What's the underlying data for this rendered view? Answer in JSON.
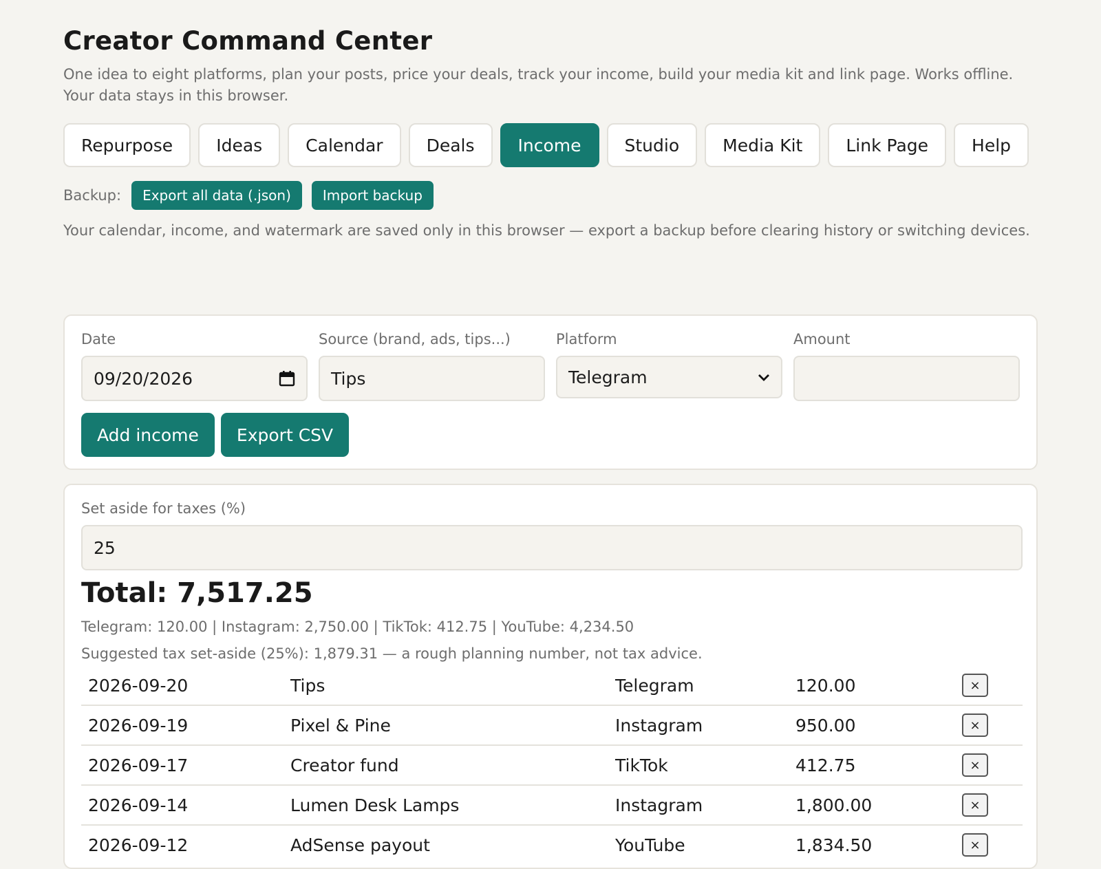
{
  "app": {
    "title": "Creator Command Center",
    "subtitle": "One idea to eight platforms, plan your posts, price your deals, track your income, build your media kit and link page. Works offline. Your data stays in this browser."
  },
  "tabs": [
    {
      "label": "Repurpose",
      "active": false
    },
    {
      "label": "Ideas",
      "active": false
    },
    {
      "label": "Calendar",
      "active": false
    },
    {
      "label": "Deals",
      "active": false
    },
    {
      "label": "Income",
      "active": true
    },
    {
      "label": "Studio",
      "active": false
    },
    {
      "label": "Media Kit",
      "active": false
    },
    {
      "label": "Link Page",
      "active": false
    },
    {
      "label": "Help",
      "active": false
    }
  ],
  "backup": {
    "label": "Backup:",
    "export_label": "Export all data (.json)",
    "import_label": "Import backup",
    "note": "Your calendar, income, and watermark are saved only in this browser — export a backup before clearing history or switching devices."
  },
  "form": {
    "date_label": "Date",
    "date_value": "09/20/2026",
    "source_label": "Source (brand, ads, tips...)",
    "source_value": "Tips",
    "platform_label": "Platform",
    "platform_value": "Telegram",
    "amount_label": "Amount",
    "amount_value": "",
    "add_label": "Add income",
    "export_csv_label": "Export CSV"
  },
  "summary": {
    "tax_label": "Set aside for taxes (%)",
    "tax_value": "25",
    "total": "Total: 7,517.25",
    "breakdown": "Telegram: 120.00 | Instagram: 2,750.00 | TikTok: 412.75 | YouTube: 4,234.50",
    "suggestion": "Suggested tax set-aside (25%): 1,879.31 — a rough planning number, not tax advice."
  },
  "entries": [
    {
      "date": "2026-09-20",
      "source": "Tips",
      "platform": "Telegram",
      "amount": "120.00",
      "delete": "×"
    },
    {
      "date": "2026-09-19",
      "source": "Pixel & Pine",
      "platform": "Instagram",
      "amount": "950.00",
      "delete": "×"
    },
    {
      "date": "2026-09-17",
      "source": "Creator fund",
      "platform": "TikTok",
      "amount": "412.75",
      "delete": "×"
    },
    {
      "date": "2026-09-14",
      "source": "Lumen Desk Lamps",
      "platform": "Instagram",
      "amount": "1,800.00",
      "delete": "×"
    },
    {
      "date": "2026-09-12",
      "source": "AdSense payout",
      "platform": "YouTube",
      "amount": "1,834.50",
      "delete": "×"
    }
  ],
  "colors": {
    "accent": "#157a70",
    "background": "#f5f4f0",
    "muted_text": "#6d6d6d"
  },
  "icons": {
    "date_picker": "calendar-icon",
    "select": "chevron-down-icon",
    "delete": "close-icon"
  }
}
